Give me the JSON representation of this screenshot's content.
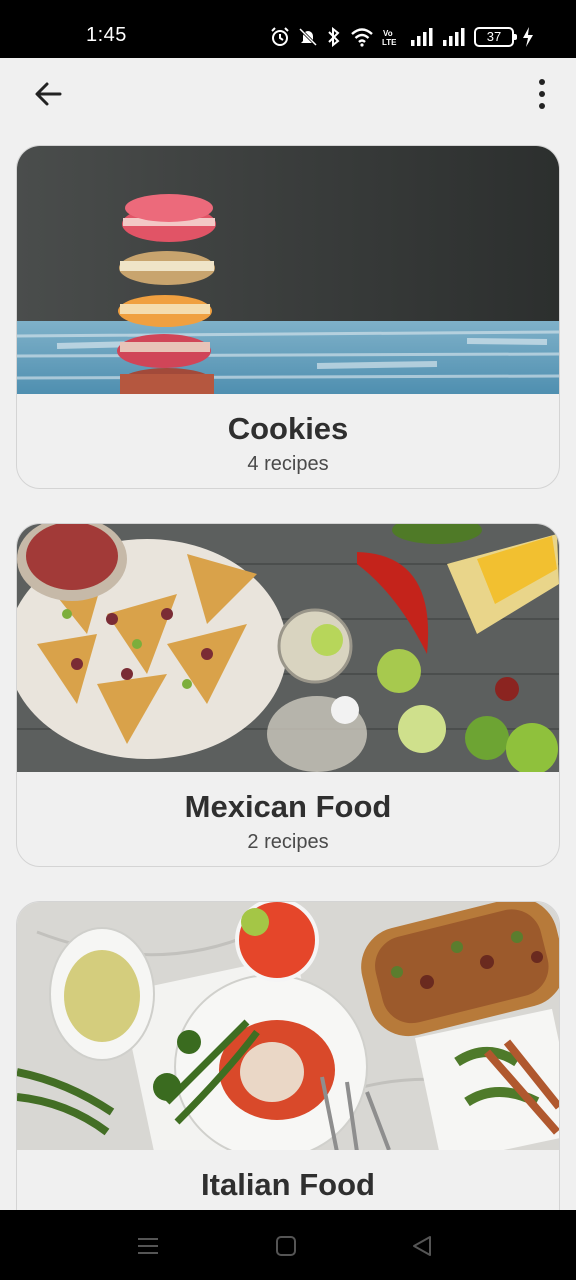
{
  "status_bar": {
    "time": "1:45",
    "battery": "37",
    "icons": [
      "alarm-icon",
      "mute-icon",
      "bluetooth-icon",
      "wifi-icon",
      "volte-icon",
      "signal-icon",
      "signal-icon",
      "battery-icon",
      "charging-icon"
    ]
  },
  "app_bar": {
    "back_icon": "arrow-left-icon",
    "menu_icon": "more-vertical-icon"
  },
  "categories": [
    {
      "title": "Cookies",
      "subtitle": "4 recipes",
      "image": "macarons-stack-photo"
    },
    {
      "title": "Mexican Food",
      "subtitle": "2 recipes",
      "image": "nachos-and-vegetables-photo"
    },
    {
      "title": "Italian Food",
      "subtitle": "",
      "image": "italian-dishes-table-photo"
    }
  ],
  "nav_bar": {
    "icons": [
      "menu-icon",
      "home-icon",
      "back-triangle-icon"
    ]
  },
  "colors": {
    "background": "#f0f0f0",
    "status_bar": "#000000",
    "card_border": "#d4d4d4",
    "text": "#2f2f2f"
  }
}
